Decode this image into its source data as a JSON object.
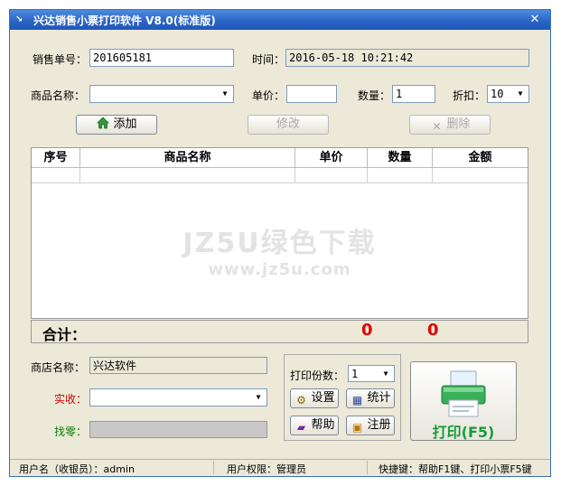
{
  "window": {
    "title": "兴达销售小票打印软件 V8.0(标准版)"
  },
  "header": {
    "order_no_label": "销售单号：",
    "order_no_value": "201605181",
    "time_label": "时间：",
    "time_value": "2016-05-18 10:21:42"
  },
  "entry": {
    "product_label": "商品名称：",
    "product_value": "",
    "price_label": "单价：",
    "price_value": "",
    "qty_label": "数量：",
    "qty_value": "1",
    "discount_label": "折扣：",
    "discount_value": "10"
  },
  "actions": {
    "add": "添加",
    "edit": "修改",
    "delete": "删除"
  },
  "table": {
    "columns": [
      "序号",
      "商品名称",
      "单价",
      "数量",
      "金额"
    ],
    "rows": []
  },
  "watermark": {
    "line1": "JZ5U绿色下载",
    "line2": "www.jz5u.com"
  },
  "summary": {
    "label": "合计：",
    "qty_total": "0",
    "amount_total": "0"
  },
  "footer": {
    "shop_label": "商店名称：",
    "shop_value": "兴达软件",
    "paid_label": "实收：",
    "paid_value": "",
    "change_label": "找零：",
    "change_value": "",
    "copies_label": "打印份数：",
    "copies_value": "1",
    "settings": "设置",
    "stats": "统计",
    "help": "帮助",
    "register": "注册",
    "print": "打印(F5)"
  },
  "statusbar": {
    "user": "用户名（收银员）：admin",
    "permission": "用户权限：管理员",
    "hotkeys": "快捷键：帮助F1键、打印小票F5键"
  },
  "colors": {
    "title_bar": "#2b63c5",
    "total_red": "#e00000",
    "paid_label": "#cc0000",
    "change_label": "#008000",
    "print_green": "#1a9a3a"
  }
}
